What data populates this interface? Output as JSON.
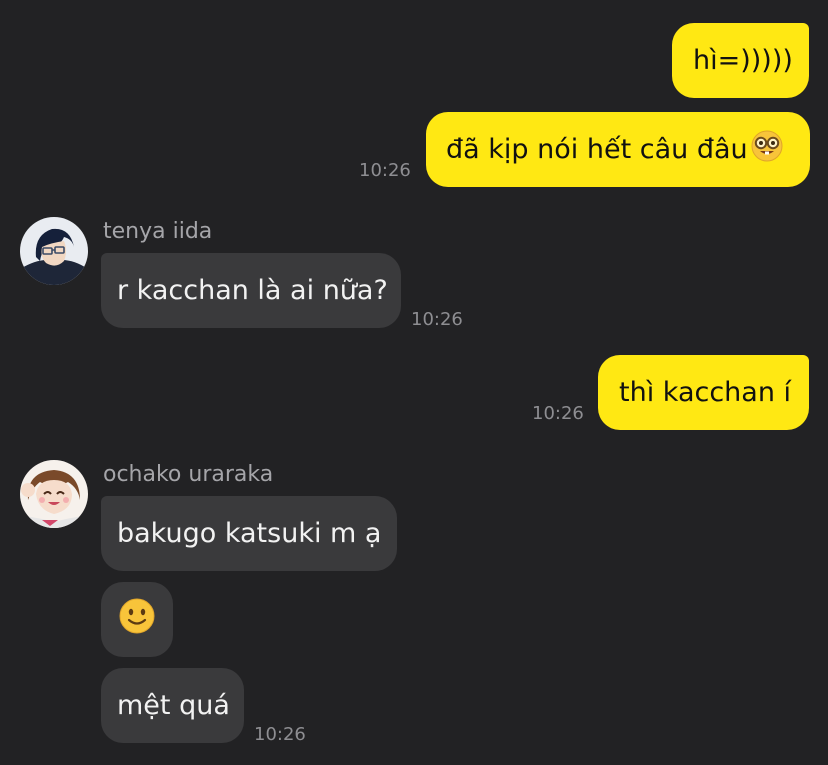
{
  "messages": [
    {
      "text": "hì=)))))"
    },
    {
      "text": "đã kịp nói hết câu đâu",
      "emoji": "nerd-face",
      "time": "10:26"
    },
    {
      "sender": "tenya iida",
      "avatar": "tenya-iida-avatar",
      "text": "r kacchan là ai nữa?",
      "time": "10:26"
    },
    {
      "text": "thì kacchan í",
      "time": "10:26"
    },
    {
      "sender": "ochako uraraka",
      "avatar": "ochako-uraraka-avatar",
      "text": "bakugo katsuki m ạ"
    },
    {
      "emoji": "slightly-smiling-face"
    },
    {
      "text": "mệt quá",
      "time": "10:26"
    }
  ],
  "colors": {
    "background": "#222224",
    "outgoing_bubble": "#FFE813",
    "incoming_bubble": "#3A3A3C",
    "timestamp": "#8E8E92",
    "sender_name": "#A5A5A9"
  }
}
